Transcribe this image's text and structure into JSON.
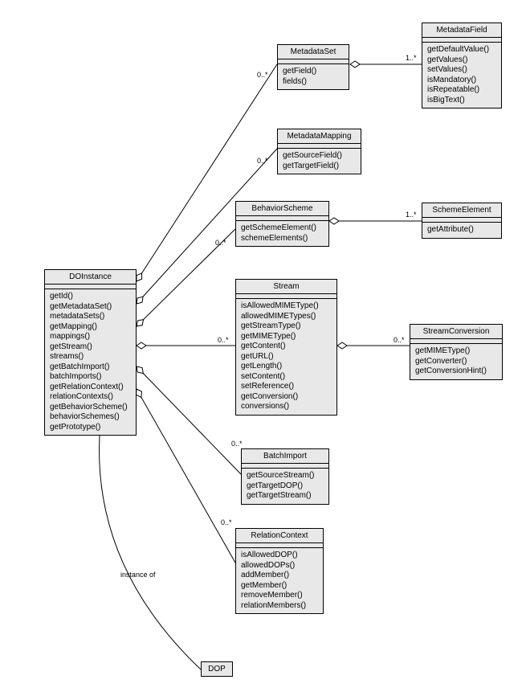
{
  "diagram_type": "UML class diagram",
  "classes": {
    "DOInstance": {
      "name": "DOInstance",
      "attributes": [],
      "operations": [
        "getId()",
        "getMetadataSet()",
        "metadataSets()",
        "getMapping()",
        "mappings()",
        "getStream()",
        "streams()",
        "getBatchImport()",
        "batchImports()",
        "getRelationContext()",
        "relationContexts()",
        "getBehaviorScheme()",
        "behaviorSchemes()",
        "getPrototype()"
      ]
    },
    "MetadataSet": {
      "name": "MetadataSet",
      "attributes": [],
      "operations": [
        "getField()",
        "fields()"
      ]
    },
    "MetadataField": {
      "name": "MetadataField",
      "attributes": [],
      "operations": [
        "getDefaultValue()",
        "getValues()",
        "setValues()",
        "isMandatory()",
        "isRepeatable()",
        "isBigText()"
      ]
    },
    "MetadataMapping": {
      "name": "MetadataMapping",
      "attributes": [],
      "operations": [
        "getSourceField()",
        "getTargetField()"
      ]
    },
    "BehaviorScheme": {
      "name": "BehaviorScheme",
      "attributes": [],
      "operations": [
        "getSchemeElement()",
        "schemeElements()"
      ]
    },
    "SchemeElement": {
      "name": "SchemeElement",
      "attributes": [],
      "operations": [
        "getAttribute()"
      ]
    },
    "Stream": {
      "name": "Stream",
      "attributes": [],
      "operations": [
        "isAllowedMIMEType()",
        "allowedMIMETypes()",
        "getStreamType()",
        "getMIMEType()",
        "getContent()",
        "getURL()",
        "getLength()",
        "setContent()",
        "setReference()",
        "getConversion()",
        "conversions()"
      ]
    },
    "StreamConversion": {
      "name": "StreamConversion",
      "attributes": [],
      "operations": [
        "getMIMEType()",
        "getConverter()",
        "getConversionHint()"
      ]
    },
    "BatchImport": {
      "name": "BatchImport",
      "attributes": [],
      "operations": [
        "getSourceStream()",
        "getTargetDOP()",
        "getTargetStream()"
      ]
    },
    "RelationContext": {
      "name": "RelationContext",
      "attributes": [],
      "operations": [
        "isAllowedDOP()",
        "allowedDOPs()",
        "addMember()",
        "getMember()",
        "removeMember()",
        "relationMembers()"
      ]
    },
    "DOP": {
      "name": "DOP",
      "attributes": [],
      "operations": []
    }
  },
  "relations": [
    {
      "from": "DOInstance",
      "to": "MetadataSet",
      "type": "aggregation",
      "mult_to": "0..*"
    },
    {
      "from": "MetadataSet",
      "to": "MetadataField",
      "type": "aggregation",
      "mult_to": "1..*"
    },
    {
      "from": "DOInstance",
      "to": "MetadataMapping",
      "type": "aggregation",
      "mult_to": "0..*"
    },
    {
      "from": "DOInstance",
      "to": "BehaviorScheme",
      "type": "aggregation",
      "mult_to": "0..*"
    },
    {
      "from": "BehaviorScheme",
      "to": "SchemeElement",
      "type": "aggregation",
      "mult_to": "1..*"
    },
    {
      "from": "DOInstance",
      "to": "Stream",
      "type": "aggregation",
      "mult_to": "0..*"
    },
    {
      "from": "Stream",
      "to": "StreamConversion",
      "type": "aggregation",
      "mult_to": "0..*"
    },
    {
      "from": "DOInstance",
      "to": "BatchImport",
      "type": "aggregation",
      "mult_to": "0..*"
    },
    {
      "from": "DOInstance",
      "to": "RelationContext",
      "type": "aggregation",
      "mult_to": "0..*"
    },
    {
      "from": "DOInstance",
      "to": "DOP",
      "type": "association",
      "label": "instance of"
    }
  ],
  "labels": {
    "m_metadataset": "0..*",
    "m_metadatafield": "1..*",
    "m_metadatamapping": "0..*",
    "m_behaviorscheme": "0..*",
    "m_schemeelement": "1..*",
    "m_stream": "0..*",
    "m_streamconversion": "0..*",
    "m_batchimport": "0..*",
    "m_relationcontext": "0..*",
    "instance_of": "instance of"
  }
}
